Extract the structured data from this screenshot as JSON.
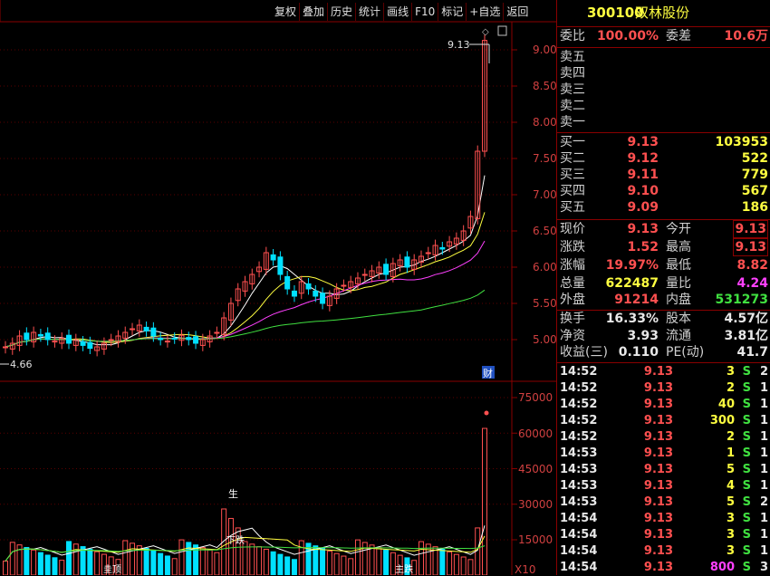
{
  "toolbar": [
    "复权",
    "叠加",
    "历史",
    "统计",
    "画线",
    "F10",
    "标记",
    "+自选",
    "返回"
  ],
  "stock": {
    "code": "300100",
    "name": "双林股份"
  },
  "price_chart": {
    "y_ticks": [
      "9.00",
      "8.50",
      "8.00",
      "7.50",
      "7.00",
      "6.50",
      "6.00",
      "5.50",
      "5.00"
    ],
    "high_label": "9.13",
    "low_label": "4.66",
    "fin_badge": "财"
  },
  "volume_chart": {
    "y_ticks": [
      "75000",
      "60000",
      "45000",
      "30000",
      "15000"
    ],
    "unit": "X10",
    "sheng_label": "生",
    "bottom_labels": [
      "圭顶",
      "下跌",
      "主跌"
    ]
  },
  "colors": {
    "up": "#ff5050",
    "down": "#00e0ff",
    "ma5": "#ffffff",
    "ma10": "#ffff40",
    "ma20": "#ff40ff",
    "ma60": "#40e040"
  },
  "panel": {
    "weibi_label": "委比",
    "weibi": "100.00%",
    "weicha_label": "委差",
    "weicha": "10.6万",
    "asks": [
      {
        "label": "卖五"
      },
      {
        "label": "卖四"
      },
      {
        "label": "卖三"
      },
      {
        "label": "卖二"
      },
      {
        "label": "卖一"
      }
    ],
    "bids": [
      {
        "label": "买一",
        "price": "9.13",
        "vol": "103953"
      },
      {
        "label": "买二",
        "price": "9.12",
        "vol": "522"
      },
      {
        "label": "买三",
        "price": "9.11",
        "vol": "779"
      },
      {
        "label": "买四",
        "price": "9.10",
        "vol": "567"
      },
      {
        "label": "买五",
        "price": "9.09",
        "vol": "186"
      }
    ],
    "quote": [
      {
        "l1": "现价",
        "v1": "9.13",
        "l2": "今开",
        "v2": "9.13"
      },
      {
        "l1": "涨跌",
        "v1": "1.52",
        "l2": "最高",
        "v2": "9.13"
      },
      {
        "l1": "涨幅",
        "v1": "19.97%",
        "l2": "最低",
        "v2": "8.82"
      },
      {
        "l1": "总量",
        "v1": "622487",
        "l2": "量比",
        "v2": "4.24"
      },
      {
        "l1": "外盘",
        "v1": "91214",
        "l2": "内盘",
        "v2": "531273"
      }
    ],
    "finance": [
      {
        "l1": "换手",
        "v1": "16.33%",
        "l2": "股本",
        "v2": "4.57亿"
      },
      {
        "l1": "净资",
        "v1": "3.93",
        "l2": "流通",
        "v2": "3.81亿"
      },
      {
        "l1": "收益(三)",
        "v1": "0.110",
        "l2": "PE(动)",
        "v2": "41.7"
      }
    ],
    "ticks": [
      {
        "t": "14:52",
        "p": "9.13",
        "v": "3",
        "s": "S",
        "n": "2"
      },
      {
        "t": "14:52",
        "p": "9.13",
        "v": "2",
        "s": "S",
        "n": "1"
      },
      {
        "t": "14:52",
        "p": "9.13",
        "v": "40",
        "s": "S",
        "n": "1"
      },
      {
        "t": "14:52",
        "p": "9.13",
        "v": "300",
        "s": "S",
        "n": "1"
      },
      {
        "t": "14:52",
        "p": "9.13",
        "v": "2",
        "s": "S",
        "n": "1"
      },
      {
        "t": "14:53",
        "p": "9.13",
        "v": "1",
        "s": "S",
        "n": "1"
      },
      {
        "t": "14:53",
        "p": "9.13",
        "v": "5",
        "s": "S",
        "n": "1"
      },
      {
        "t": "14:53",
        "p": "9.13",
        "v": "4",
        "s": "S",
        "n": "1"
      },
      {
        "t": "14:53",
        "p": "9.13",
        "v": "5",
        "s": "S",
        "n": "2"
      },
      {
        "t": "14:54",
        "p": "9.13",
        "v": "3",
        "s": "S",
        "n": "1"
      },
      {
        "t": "14:54",
        "p": "9.13",
        "v": "3",
        "s": "S",
        "n": "1"
      },
      {
        "t": "14:54",
        "p": "9.13",
        "v": "3",
        "s": "S",
        "n": "1"
      },
      {
        "t": "14:54",
        "p": "9.13",
        "v": "800",
        "s": "S",
        "n": "3"
      }
    ]
  }
}
